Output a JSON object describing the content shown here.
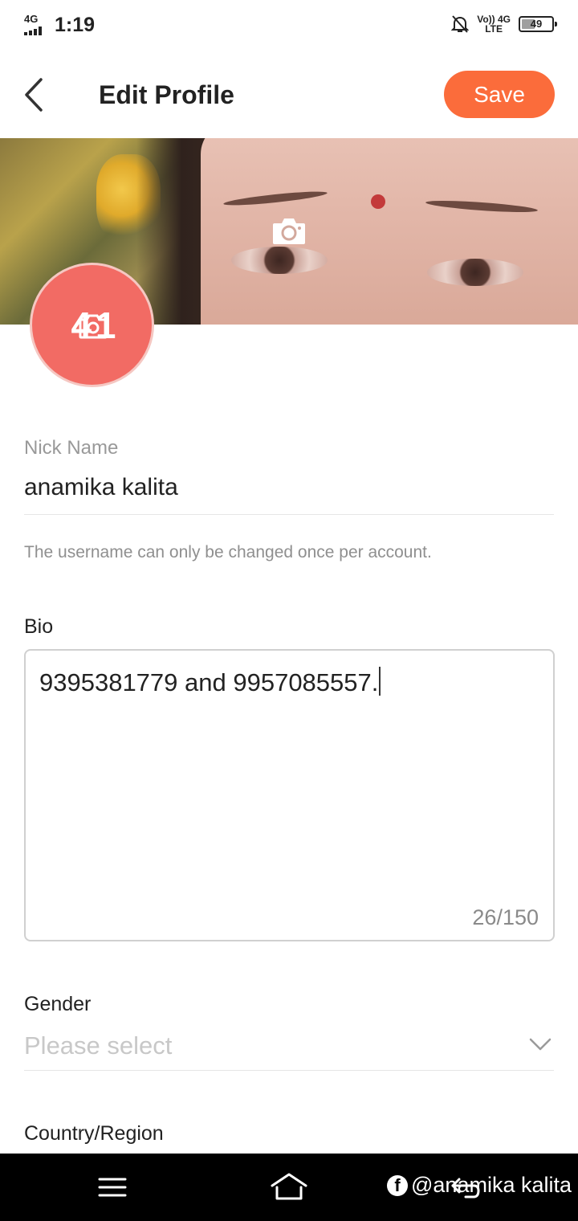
{
  "status_bar": {
    "network": "4G",
    "time": "1:19",
    "volte_top": "Vo)) 4G",
    "volte_bottom": "LTE",
    "battery": "49",
    "battery_level": 0.49
  },
  "header": {
    "title": "Edit Profile",
    "save_label": "Save"
  },
  "avatar": {
    "logo_text": "4 1"
  },
  "nickname": {
    "label": "Nick Name",
    "value": "anamika kalita",
    "hint": "The username can only be changed once per account."
  },
  "bio": {
    "label": "Bio",
    "value": "9395381779 and 9957085557.",
    "counter": "26/150"
  },
  "gender": {
    "label": "Gender",
    "placeholder": "Please select"
  },
  "country": {
    "label": "Country/Region"
  },
  "watermark": {
    "text": "@anamika kalita"
  },
  "icons": {
    "back": "chevron-left-icon",
    "camera": "camera-icon",
    "dropdown": "chevron-down-icon",
    "nav_menu": "menu-icon",
    "nav_home": "home-icon",
    "nav_back": "back-icon",
    "facebook": "facebook-icon"
  },
  "colors": {
    "accent": "#fb6c3b",
    "avatar": "#f26b64"
  }
}
